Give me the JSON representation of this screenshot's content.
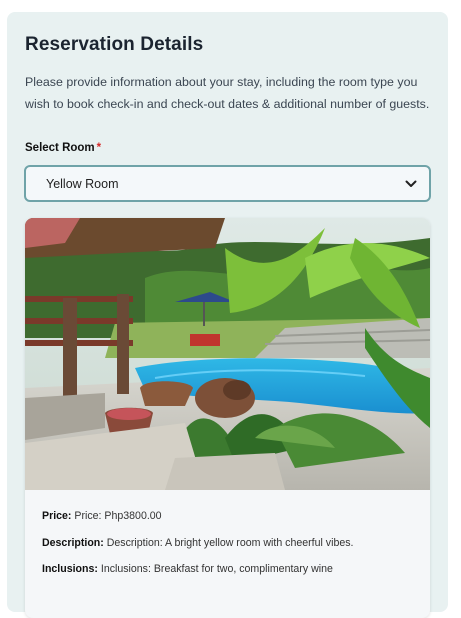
{
  "form": {
    "title": "Reservation Details",
    "intro": "Please provide information about your stay, including the room type you wish to book check-in and check-out dates & additional number of guests.",
    "select_label": "Select Room",
    "required_mark": "*",
    "selected_room": "Yellow Room"
  },
  "room": {
    "image_icon": "resort-pool-photo",
    "price_label": "Price:",
    "price_text": "Price: Php3800.00",
    "description_label": "Description:",
    "description_text": "Description: A bright yellow room with cheerful vibes.",
    "inclusions_label": "Inclusions:",
    "inclusions_text": "Inclusions: Breakfast for two, complimentary wine"
  },
  "colors": {
    "card_bg": "#e8f1f1",
    "select_border": "#6fa3a8",
    "required": "#d62a2a"
  }
}
